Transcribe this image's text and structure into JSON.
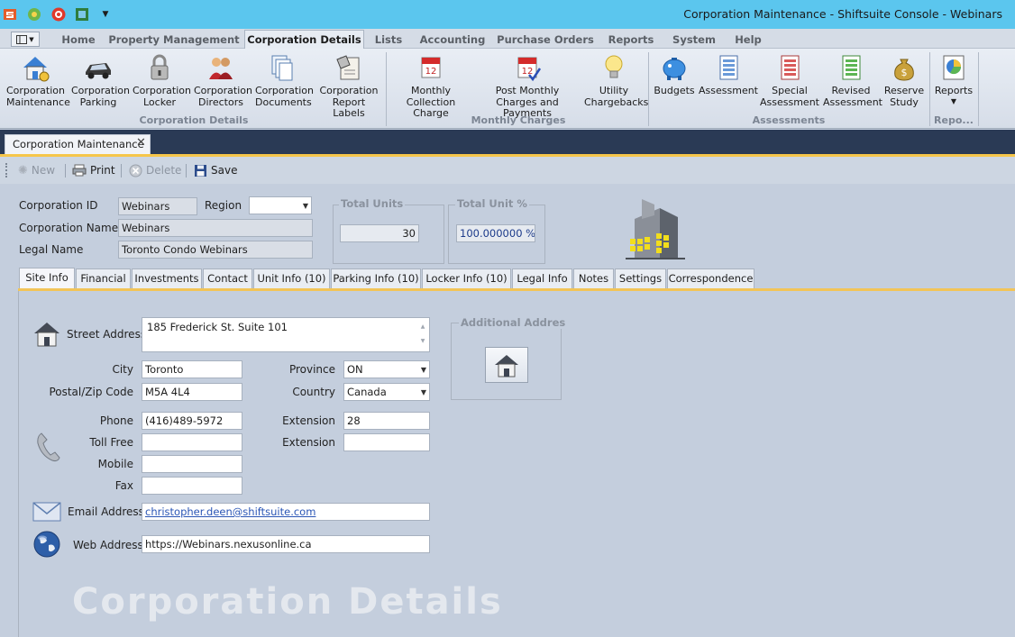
{
  "window": {
    "title": "Corporation Maintenance - Shiftsuite Console - Webinars"
  },
  "menu": {
    "tabs": [
      "Home",
      "Property Management",
      "Corporation Details",
      "Lists",
      "Accounting",
      "Purchase Orders",
      "Reports",
      "System",
      "Help"
    ],
    "active": "Corporation Details"
  },
  "ribbon": {
    "buttons": [
      "Corporation Maintenance",
      "Corporation Parking",
      "Corporation Locker",
      "Corporation Directors",
      "Corporation Documents",
      "Corporation Report Labels",
      "Monthly Collection Charge",
      "Post Monthly Charges and Payments",
      "Utility Chargebacks",
      "Budgets",
      "Assessment",
      "Special Assessment",
      "Revised Assessment",
      "Reserve Study",
      "Reports"
    ],
    "groups": [
      "Corporation Details",
      "Monthly Charges",
      "Assessments",
      "Repo..."
    ]
  },
  "document_tab": {
    "label": "Corporation Maintenance"
  },
  "toolbar": {
    "new": "New",
    "print": "Print",
    "delete": "Delete",
    "save": "Save"
  },
  "header": {
    "corporation_id_label": "Corporation ID",
    "corporation_id": "Webinars",
    "region_label": "Region",
    "region": "",
    "corporation_name_label": "Corporation Name",
    "corporation_name": "Webinars",
    "legal_name_label": "Legal Name",
    "legal_name": "Toronto Condo Webinars",
    "total_units_label": "Total Units",
    "total_units": "30",
    "total_unit_pct_label": "Total Unit %",
    "total_unit_pct": "100.000000 %"
  },
  "tabs": [
    "Site Info",
    "Financial",
    "Investments",
    "Contact",
    "Unit Info (10)",
    "Parking Info (10)",
    "Locker Info (10)",
    "Legal Info",
    "Notes",
    "Settings",
    "Correspondence"
  ],
  "site_info": {
    "street_address_label": "Street Address",
    "street_address": "185 Frederick St. Suite 101",
    "city_label": "City",
    "city": "Toronto",
    "province_label": "Province",
    "province": "ON",
    "postal_label": "Postal/Zip Code",
    "postal": "M5A 4L4",
    "country_label": "Country",
    "country": "Canada",
    "phone_label": "Phone",
    "phone": "(416)489-5972",
    "extension_label": "Extension",
    "extension": "28",
    "tollfree_label": "Toll Free",
    "tollfree": "",
    "extension2_label": "Extension",
    "extension2": "",
    "mobile_label": "Mobile",
    "mobile": "",
    "fax_label": "Fax",
    "fax": "",
    "email_label": "Email Address",
    "email": "christopher.deen@shiftsuite.com",
    "web_label": "Web Address",
    "web": "https://Webinars.nexusonline.ca",
    "additional_address_label": "Additional Addres",
    "watermark": "Corporation Details"
  }
}
